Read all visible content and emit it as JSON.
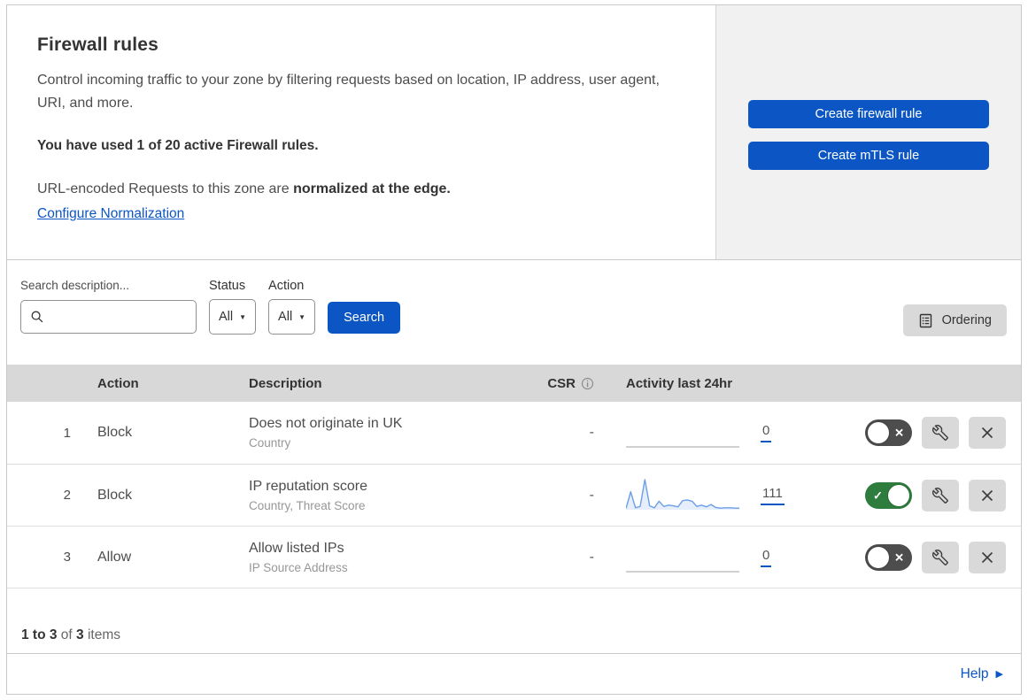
{
  "header": {
    "title": "Firewall rules",
    "description": "Control incoming traffic to your zone by filtering requests based on location, IP address, user agent, URI, and more.",
    "usage_bold": "You have used 1 of 20 active Firewall rules.",
    "normalization_text": "URL-encoded Requests to this zone are ",
    "normalization_bold": "normalized at the edge.",
    "normalization_link": "Configure Normalization",
    "create_firewall_label": "Create firewall rule",
    "create_mtls_label": "Create mTLS rule"
  },
  "toolbar": {
    "search_label": "Search description...",
    "search_value": "",
    "status_label": "Status",
    "status_value": "All",
    "action_label": "Action",
    "action_value": "All",
    "search_button": "Search",
    "ordering_button": "Ordering"
  },
  "table": {
    "headers": {
      "action": "Action",
      "description": "Description",
      "csr": "CSR",
      "activity": "Activity last 24hr"
    },
    "rows": [
      {
        "index": "1",
        "action": "Block",
        "description": "Does not originate in UK",
        "fields": "Country",
        "csr": "-",
        "activity_count": "0",
        "enabled": false,
        "sparkline": [
          0,
          0,
          0,
          0,
          0,
          0,
          0,
          0,
          0,
          0
        ]
      },
      {
        "index": "2",
        "action": "Block",
        "description": "IP reputation score",
        "fields": "Country, Threat Score",
        "csr": "-",
        "activity_count": "111",
        "enabled": true,
        "sparkline": [
          4,
          55,
          6,
          10,
          92,
          12,
          6,
          26,
          10,
          14,
          12,
          9,
          28,
          30,
          26,
          10,
          14,
          9,
          16,
          7,
          5,
          6,
          6,
          5,
          5
        ]
      },
      {
        "index": "3",
        "action": "Allow",
        "description": "Allow listed IPs",
        "fields": "IP Source Address",
        "csr": "-",
        "activity_count": "0",
        "enabled": false,
        "sparkline": [
          0,
          0,
          0,
          0,
          0,
          0,
          0,
          0,
          0,
          0
        ]
      }
    ]
  },
  "footer": {
    "range_bold": "1 to 3",
    "of_text": "of",
    "total_bold": "3",
    "items_text": "items",
    "help_label": "Help"
  },
  "icons": {
    "caret": "▼",
    "check": "✓",
    "cross": "✕",
    "help_arrow": "▶"
  },
  "colors": {
    "accent": "#0b56c4",
    "toggle_on": "#2e7d3e",
    "toggle_off": "#4d4d4d",
    "spark_line": "#6d9ee8",
    "spark_fill": "rgba(110,160,230,0.18)",
    "spark_flat": "#b3b3b3"
  }
}
